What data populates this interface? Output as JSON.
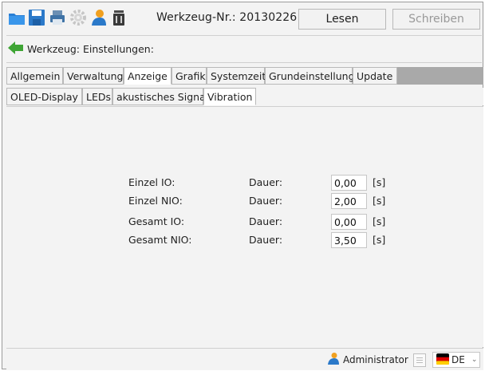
{
  "toolbar": {
    "tool_number_label": "Werkzeug-Nr.: 20130226",
    "read_label": "Lesen",
    "write_label": "Schreiben"
  },
  "breadcrumb": {
    "label": "Werkzeug: Einstellungen:"
  },
  "tabs": [
    {
      "label": "Allgemein",
      "active": false
    },
    {
      "label": "Verwaltung",
      "active": false
    },
    {
      "label": "Anzeige",
      "active": true
    },
    {
      "label": "Grafik",
      "active": false
    },
    {
      "label": "Systemzeit",
      "active": false
    },
    {
      "label": "Grundeinstellung",
      "active": false
    },
    {
      "label": "Update",
      "active": false
    }
  ],
  "subtabs": [
    {
      "label": "OLED-Display",
      "active": false
    },
    {
      "label": "LEDs",
      "active": false
    },
    {
      "label": "akustisches Signal",
      "active": false
    },
    {
      "label": "Vibration",
      "active": true
    }
  ],
  "vibration": {
    "rows": [
      {
        "name": "Einzel IO:",
        "duration_label": "Dauer:",
        "value": "0,00",
        "unit": "[s]"
      },
      {
        "name": "Einzel NIO:",
        "duration_label": "Dauer:",
        "value": "2,00",
        "unit": "[s]"
      },
      {
        "name": "Gesamt IO:",
        "duration_label": "Dauer:",
        "value": "0,00",
        "unit": "[s]"
      },
      {
        "name": "Gesamt NIO:",
        "duration_label": "Dauer:",
        "value": "3,50",
        "unit": "[s]"
      }
    ]
  },
  "status": {
    "user_label": "Administrator",
    "language": "DE"
  },
  "icons": [
    "folder-open-icon",
    "save-icon",
    "print-icon",
    "gear-icon",
    "user-icon",
    "trash-icon",
    "back-arrow-icon",
    "document-icon",
    "flag-de-icon",
    "chevron-down-icon"
  ],
  "colors": {
    "tab_bar": "#a9a9a9",
    "background": "#f3f3f3",
    "arrow_green": "#3fa535"
  }
}
